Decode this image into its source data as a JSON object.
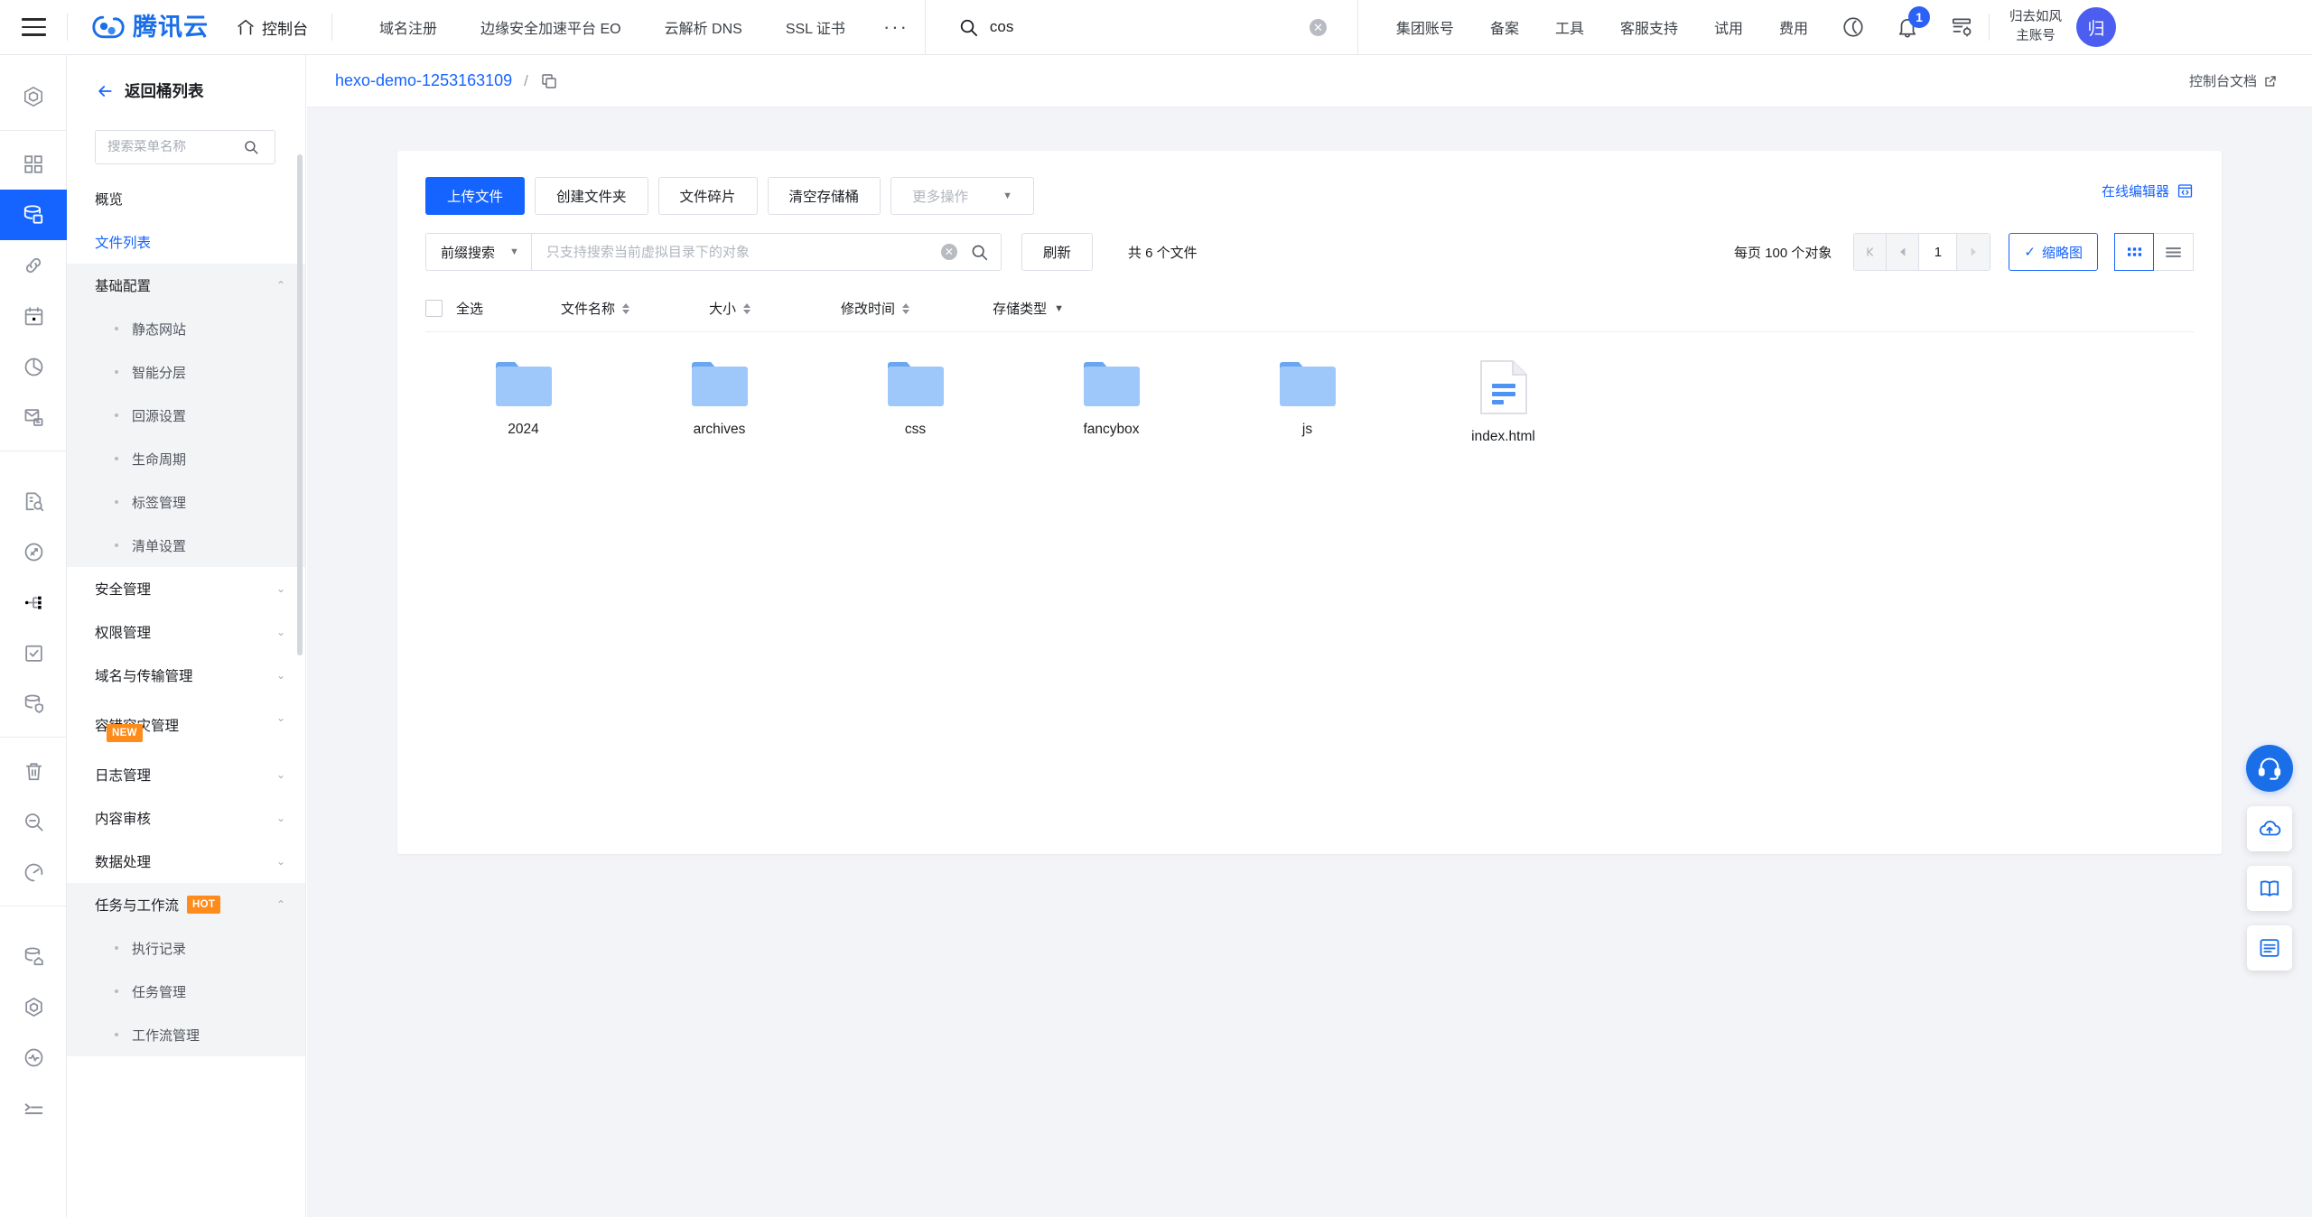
{
  "header": {
    "menu_icon": "hamburger-icon",
    "brand": "腾讯云",
    "console_label": "控制台",
    "nav": [
      {
        "label": "域名注册"
      },
      {
        "label": "边缘安全加速平台 EO"
      },
      {
        "label": "云解析 DNS"
      },
      {
        "label": "SSL 证书"
      }
    ],
    "more_dots": "···",
    "search": {
      "value": "cos",
      "placeholder": "",
      "icon": "search-icon",
      "clear": "✕"
    },
    "right_nav": [
      {
        "label": "集团账号"
      },
      {
        "label": "备案"
      },
      {
        "label": "工具"
      },
      {
        "label": "客服支持"
      },
      {
        "label": "试用"
      },
      {
        "label": "费用"
      }
    ],
    "notification_count": "1",
    "user_name": "归去如风",
    "user_type": "主账号",
    "avatar_text": "归"
  },
  "rail": {
    "items": [
      {
        "name": "cube-icon",
        "active": false
      },
      {
        "name": "grid-apps-icon",
        "active": false
      },
      {
        "name": "database-storage-icon",
        "active": true
      },
      {
        "name": "link-chain-icon",
        "active": false
      },
      {
        "name": "calendar-icon",
        "active": false
      },
      {
        "name": "pie-chart-icon",
        "active": false
      },
      {
        "name": "mail-box-icon",
        "active": false
      },
      {
        "name": "document-search-icon",
        "active": false
      },
      {
        "name": "shield-scan-icon",
        "active": false
      },
      {
        "name": "network-nodes-icon",
        "active": false
      },
      {
        "name": "checklist-icon",
        "active": false
      },
      {
        "name": "database-shield-icon",
        "active": false
      },
      {
        "name": "trash-icon",
        "active": false
      },
      {
        "name": "magnifier-minus-icon",
        "active": false
      },
      {
        "name": "speedometer-icon",
        "active": false
      },
      {
        "name": "database-home-icon",
        "active": false
      },
      {
        "name": "hexagon-icon",
        "active": false
      },
      {
        "name": "pulse-monitor-icon",
        "active": false
      },
      {
        "name": "list-indent-icon",
        "active": false
      }
    ]
  },
  "sidebar": {
    "back_label": "返回桶列表",
    "back_icon": "arrow-left-icon",
    "search_placeholder": "搜索菜单名称",
    "search_icon": "search-icon",
    "items": [
      {
        "label": "概览",
        "type": "item",
        "active": false
      },
      {
        "label": "文件列表",
        "type": "item",
        "active": true
      },
      {
        "label": "基础配置",
        "type": "group",
        "expanded": true,
        "badge": "",
        "children": [
          "静态网站",
          "智能分层",
          "回源设置",
          "生命周期",
          "标签管理",
          "清单设置"
        ]
      },
      {
        "label": "安全管理",
        "type": "group",
        "expanded": false,
        "badge": "",
        "children": []
      },
      {
        "label": "权限管理",
        "type": "group",
        "expanded": false,
        "badge": "",
        "children": []
      },
      {
        "label": "域名与传输管理",
        "type": "group",
        "expanded": false,
        "badge": "",
        "children": []
      },
      {
        "label": "容错容灾管理",
        "type": "group",
        "expanded": false,
        "badge": "NEW",
        "badge_below": true,
        "children": []
      },
      {
        "label": "日志管理",
        "type": "group",
        "expanded": false,
        "badge": "",
        "children": []
      },
      {
        "label": "内容审核",
        "type": "group",
        "expanded": false,
        "badge": "",
        "children": []
      },
      {
        "label": "数据处理",
        "type": "group",
        "expanded": false,
        "badge": "",
        "children": []
      },
      {
        "label": "任务与工作流",
        "type": "group",
        "expanded": true,
        "badge": "HOT",
        "children": [
          "执行记录",
          "任务管理",
          "工作流管理"
        ]
      }
    ]
  },
  "breadcrumb": {
    "bucket": "hexo-demo-1253163109",
    "separator": "/",
    "copy_icon": "copy-icon",
    "docs_label": "控制台文档",
    "docs_icon": "external-link-icon"
  },
  "toolbar": {
    "upload_label": "上传文件",
    "create_folder_label": "创建文件夹",
    "fragments_label": "文件碎片",
    "clear_bucket_label": "清空存储桶",
    "more_actions_label": "更多操作",
    "more_caret": "▼",
    "online_editor_label": "在线编辑器",
    "online_editor_icon": "code-window-icon"
  },
  "filter": {
    "prefix_label": "前缀搜索",
    "prefix_caret": "▼",
    "search_placeholder": "只支持搜索当前虚拟目录下的对象",
    "search_value": "",
    "clear_icon": "clear-circle-icon",
    "search_icon": "search-icon",
    "refresh_label": "刷新",
    "total_label": "共 6 个文件"
  },
  "pagination": {
    "per_page_label": "每页 100 个对象",
    "first_icon": "page-first-icon",
    "prev_icon": "page-prev-icon",
    "current_page": "1",
    "next_icon": "page-next-icon",
    "thumbnail_label": "缩略图",
    "thumbnail_check": "✓",
    "grid_view_icon": "grid-view-icon",
    "list_view_icon": "list-view-icon"
  },
  "table": {
    "select_all_label": "全选",
    "columns": [
      {
        "label": "文件名称",
        "sortable": true
      },
      {
        "label": "大小",
        "sortable": true
      },
      {
        "label": "修改时间",
        "sortable": true
      },
      {
        "label": "存储类型",
        "filter": true,
        "caret": "▼"
      }
    ]
  },
  "files": [
    {
      "name": "2024",
      "type": "folder"
    },
    {
      "name": "archives",
      "type": "folder"
    },
    {
      "name": "css",
      "type": "folder"
    },
    {
      "name": "fancybox",
      "type": "folder"
    },
    {
      "name": "js",
      "type": "folder"
    },
    {
      "name": "index.html",
      "type": "file"
    }
  ],
  "fabs": [
    {
      "name": "customer-service-icon",
      "style": "blue"
    },
    {
      "name": "feedback-cloud-icon",
      "style": "white"
    },
    {
      "name": "documentation-book-icon",
      "style": "white"
    },
    {
      "name": "settings-panel-icon",
      "style": "white"
    }
  ],
  "colors": {
    "accent": "#1664ff",
    "brand": "#1a6fe8",
    "badge_orange": "#ff8b1a",
    "folder": "#9ec8fa",
    "bg": "#f3f4f7"
  }
}
